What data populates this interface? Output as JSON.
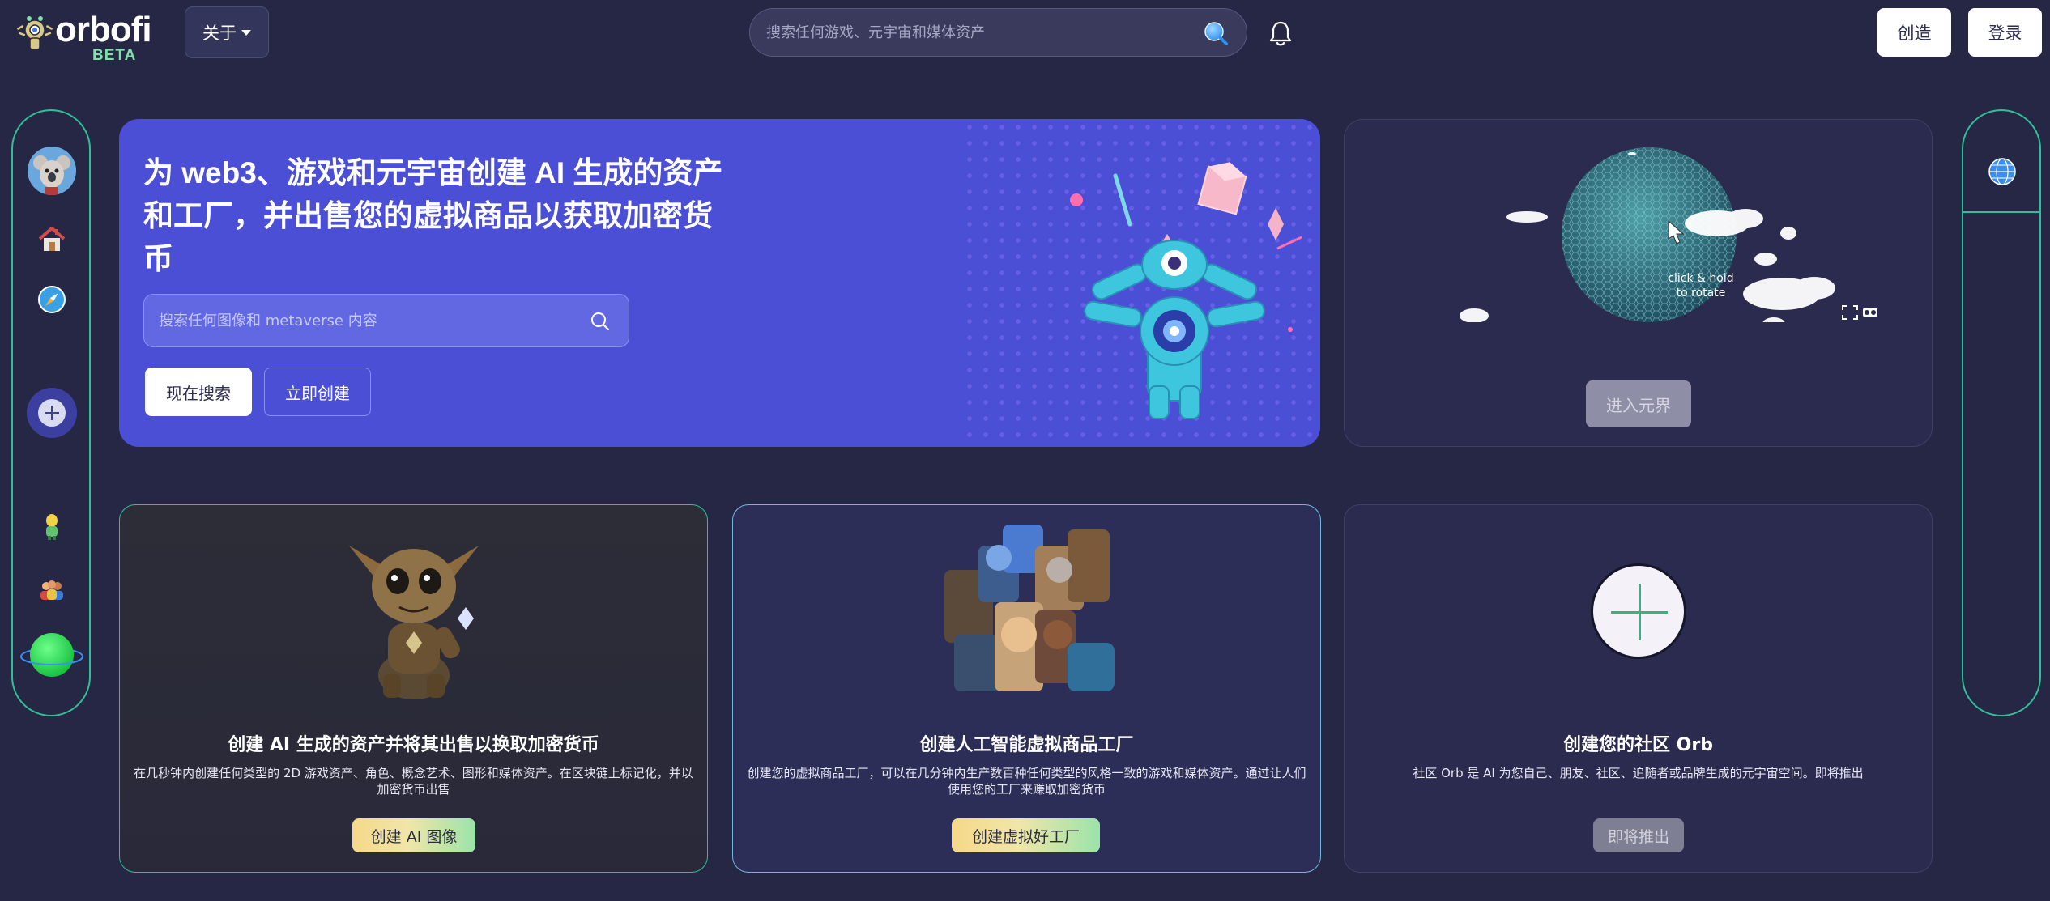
{
  "header": {
    "logo_name": "orbofi",
    "logo_badge": "BETA",
    "about_label": "关于",
    "search_placeholder": "搜索任何游戏、元宇宙和媒体资产",
    "create_label": "创造",
    "login_label": "登录"
  },
  "left_sidebar": {
    "icons": [
      "avatar",
      "home-icon",
      "compass-icon",
      "add-orb-icon",
      "character-icon",
      "community-icon",
      "orb-planet-icon"
    ]
  },
  "right_sidebar": {
    "icons": [
      "globe-icon"
    ]
  },
  "hero": {
    "title": "为 web3、游戏和元宇宙创建 AI 生成的资产和工厂，并出售您的虚拟商品以获取加密货币",
    "search_placeholder": "搜索任何图像和 metaverse 内容",
    "search_now_label": "现在搜索",
    "create_now_label": "立即创建"
  },
  "metaverse": {
    "hint": "click & hold to rotate",
    "enter_label": "进入元界"
  },
  "cards": [
    {
      "title": "创建 AI 生成的资产并将其出售以换取加密货币",
      "description": "在几秒钟内创建任何类型的 2D 游戏资产、角色、概念艺术、图形和媒体资产。在区块链上标记化，并以加密货币出售",
      "button": "创建 AI 图像"
    },
    {
      "title": "创建人工智能虚拟商品工厂",
      "description": "创建您的虚拟商品工厂，可以在几分钟内生产数百种任何类型的风格一致的游戏和媒体资产。通过让人们使用您的工厂来赚取加密货币",
      "button": "创建虚拟好工厂"
    },
    {
      "title": "创建您的社区 Orb",
      "description": "社区 Orb 是 AI 为您自己、朋友、社区、追随者或品牌生成的元宇宙空间。即将推出",
      "button": "即将推出"
    }
  ],
  "colors": {
    "background": "#262745",
    "hero": "#4b4fd6",
    "accent_green": "#2fbf9a",
    "accent_blue": "#6fb9de"
  }
}
